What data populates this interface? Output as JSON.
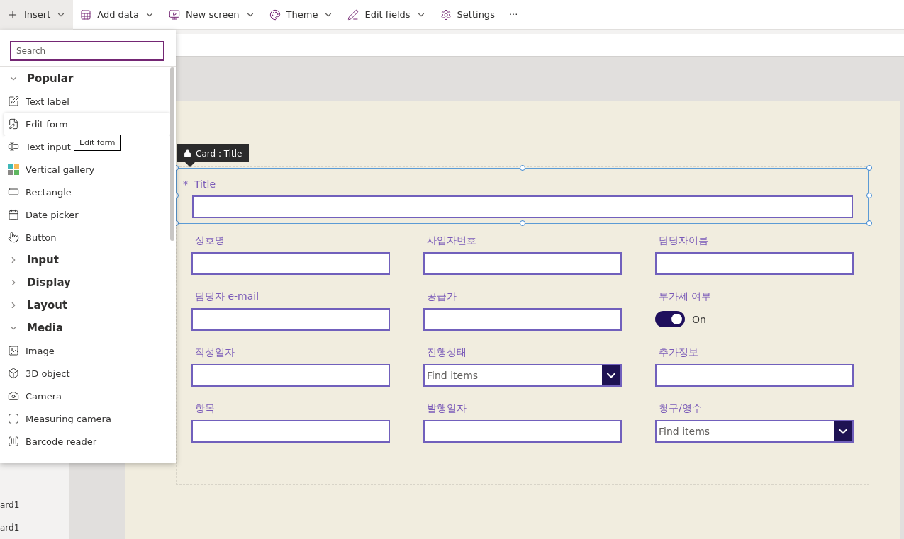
{
  "toolbar": [
    {
      "label": "Insert",
      "selected": true,
      "has_menu": true
    },
    {
      "label": "Add data",
      "selected": false,
      "has_menu": true
    },
    {
      "label": "New screen",
      "selected": false,
      "has_menu": true
    },
    {
      "label": "Theme",
      "selected": false,
      "has_menu": true
    },
    {
      "label": "Edit fields",
      "selected": false,
      "has_menu": true
    },
    {
      "label": "Settings",
      "selected": false,
      "has_menu": false
    }
  ],
  "toolbar_more": "···",
  "insert_menu": {
    "search": {
      "placeholder": "Search"
    },
    "groups": [
      {
        "label": "Popular",
        "expanded": true,
        "items": [
          {
            "label": "Text label",
            "highlighted": false
          },
          {
            "label": "Edit form",
            "highlighted": true
          },
          {
            "label": "Text input",
            "highlighted": false
          },
          {
            "label": "Vertical gallery",
            "highlighted": false
          },
          {
            "label": "Rectangle",
            "highlighted": false
          },
          {
            "label": "Date picker",
            "highlighted": false
          },
          {
            "label": "Button",
            "highlighted": false
          }
        ]
      },
      {
        "label": "Input",
        "expanded": false
      },
      {
        "label": "Display",
        "expanded": false
      },
      {
        "label": "Layout",
        "expanded": false
      },
      {
        "label": "Media",
        "expanded": true,
        "items": [
          {
            "label": "Image",
            "highlighted": false
          },
          {
            "label": "3D object",
            "highlighted": false
          },
          {
            "label": "Camera",
            "highlighted": false
          },
          {
            "label": "Measuring camera",
            "highlighted": false
          },
          {
            "label": "Barcode reader",
            "highlighted": false
          }
        ]
      }
    ],
    "tooltip": "Edit form"
  },
  "tree_items": [
    "ard1",
    "ard1"
  ],
  "form": {
    "selected_card_tag": "Card : Title",
    "title_field": {
      "label": "Title",
      "required_mark": "*"
    },
    "fields": [
      {
        "label": "상호명",
        "kind": "text"
      },
      {
        "label": "사업자번호",
        "kind": "text"
      },
      {
        "label": "담당자이름",
        "kind": "text"
      },
      {
        "label": "담당자 e-mail",
        "kind": "text"
      },
      {
        "label": "공급가",
        "kind": "text"
      },
      {
        "label": "부가세 여부",
        "kind": "toggle",
        "on": true,
        "value": "On"
      },
      {
        "label": "작성일자",
        "kind": "text"
      },
      {
        "label": "진행상태",
        "kind": "dropdown",
        "placeholder": "Find items"
      },
      {
        "label": "추가정보",
        "kind": "text"
      },
      {
        "label": "항목",
        "kind": "text"
      },
      {
        "label": "발행일자",
        "kind": "text"
      },
      {
        "label": "청구/영수",
        "kind": "dropdown",
        "placeholder": "Find items"
      }
    ]
  }
}
